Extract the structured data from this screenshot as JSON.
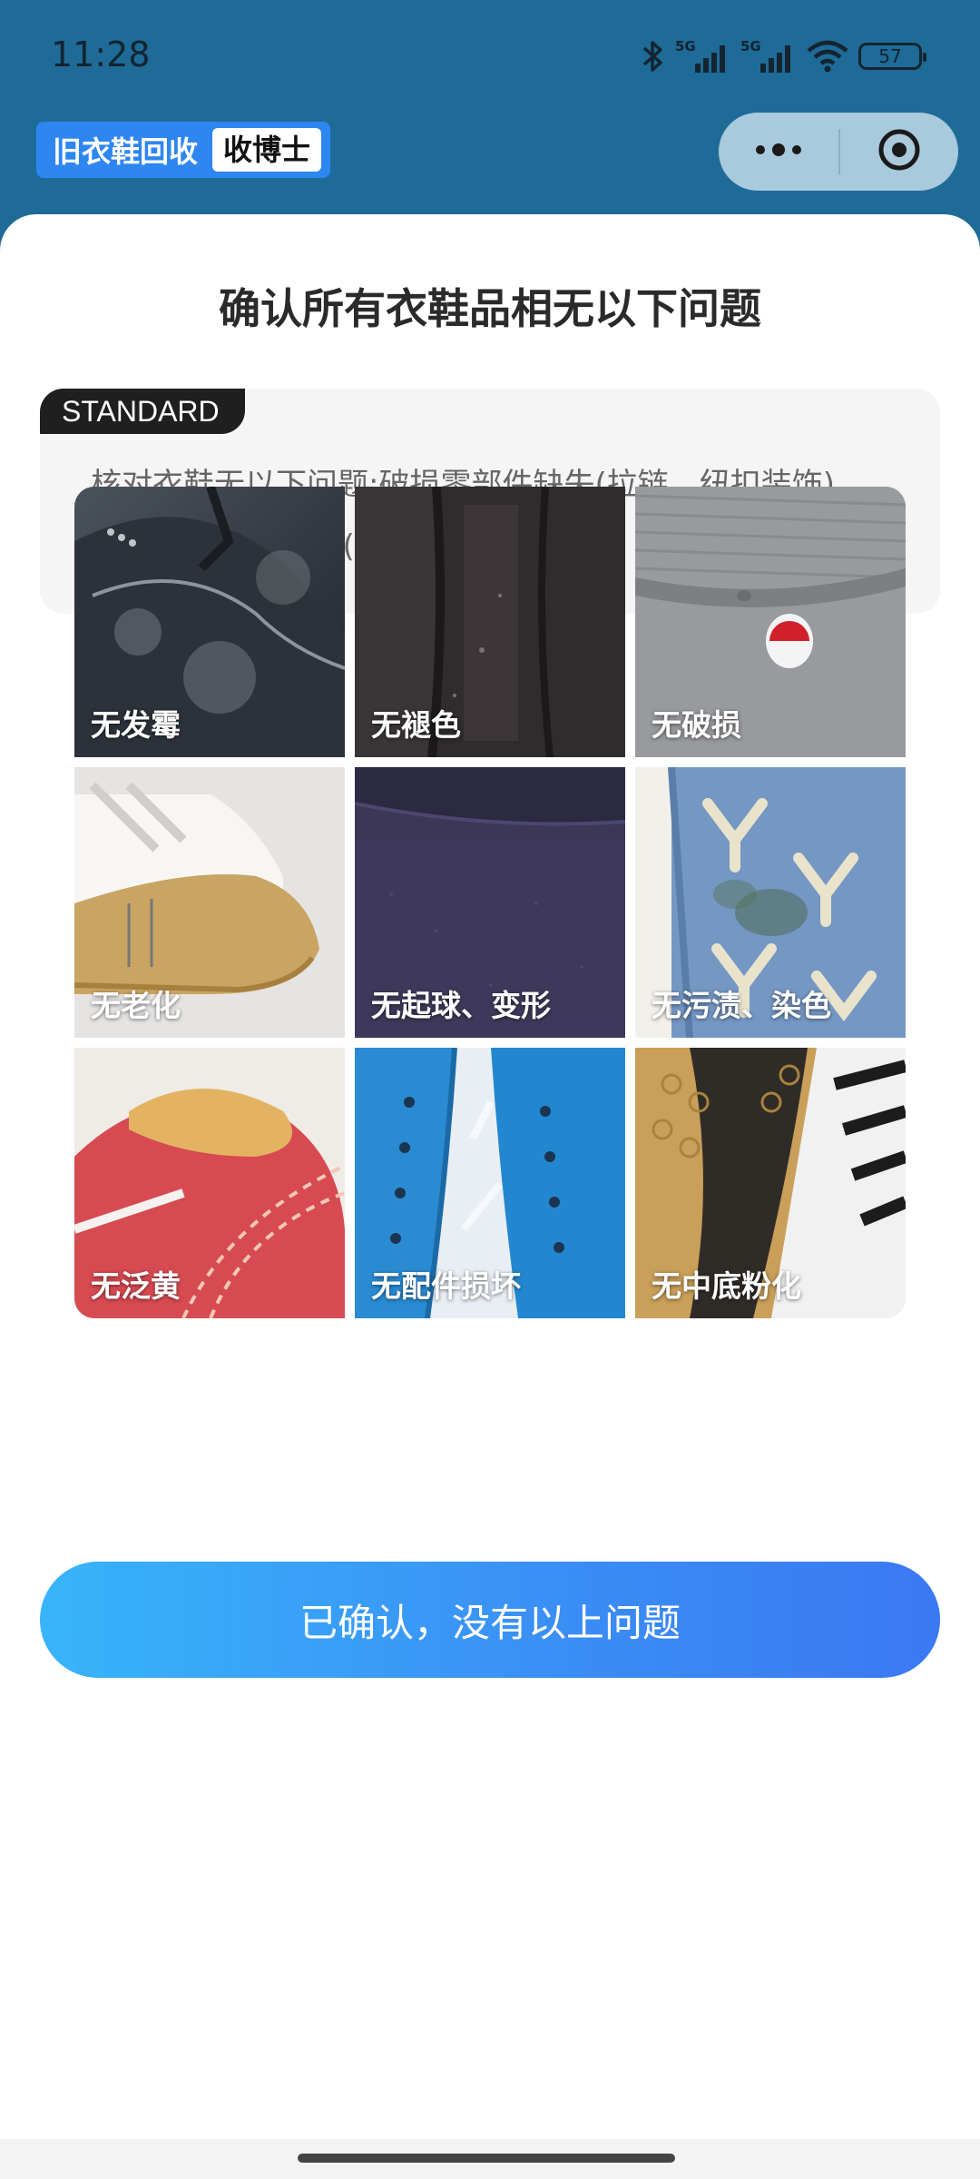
{
  "status_bar": {
    "time": "11:28",
    "battery": "57",
    "icons": [
      "bluetooth-icon",
      "signal-5g-icon",
      "signal-5g-icon",
      "wifi-icon",
      "battery-icon"
    ]
  },
  "header": {
    "brand_name": "旧衣鞋回收",
    "brand_tag": "收博士",
    "capsule_icons": [
      "more-dots-icon",
      "close-target-icon"
    ]
  },
  "sheet": {
    "title": "确认所有衣鞋品相无以下问题",
    "standard_badge": "STANDARD",
    "standard_text": "核对衣鞋无以下问题:破损零部件缺失(拉链、纽扣装饰)，直径大于1cm污渍(油渍、染色、串色)"
  },
  "grid": {
    "items": [
      {
        "label": "无发霉",
        "colors": [
          "#3b4450",
          "#2a2f38",
          "#8a9098"
        ]
      },
      {
        "label": "无褪色",
        "colors": [
          "#2b2a2c",
          "#3a3738",
          "#4a4446"
        ]
      },
      {
        "label": "无破损",
        "colors": [
          "#8d8f93",
          "#a3a5a9",
          "#c8242a"
        ]
      },
      {
        "label": "无老化",
        "colors": [
          "#e4e2e0",
          "#c9a768",
          "#f0efec"
        ]
      },
      {
        "label": "无起球、变形",
        "colors": [
          "#403a5c",
          "#34304e",
          "#2a2740"
        ]
      },
      {
        "label": "无污渍、染色",
        "colors": [
          "#6f93bf",
          "#8aa9cf",
          "#e9e2cc"
        ]
      },
      {
        "label": "无泛黄",
        "colors": [
          "#e2b15f",
          "#d8484f",
          "#f0ece8"
        ]
      },
      {
        "label": "无配件损坏",
        "colors": [
          "#2b8fd5",
          "#1f75bb",
          "#e8eef4"
        ]
      },
      {
        "label": "无中底粉化",
        "colors": [
          "#caa05a",
          "#2e2a26",
          "#f2f2f2"
        ]
      }
    ]
  },
  "confirm_button": {
    "label": "已确认，没有以上问题"
  },
  "colors": {
    "header_bg": "#1e6b98",
    "brand_bg": "#2e86f0",
    "button_gradient_start": "#38b4fb",
    "button_gradient_end": "#3a78f4"
  }
}
